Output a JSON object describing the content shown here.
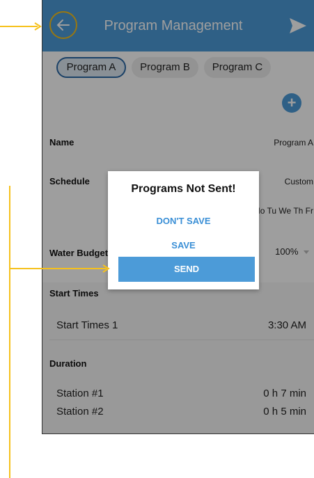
{
  "header": {
    "title": "Program Management"
  },
  "tabs": [
    {
      "label": "Program A",
      "active": true
    },
    {
      "label": "Program B",
      "active": false
    },
    {
      "label": "Program C",
      "active": false
    }
  ],
  "add_label": "+",
  "form": {
    "name_label": "Name",
    "name_value": "Program A",
    "schedule_label": "Schedule",
    "schedule_value": "Custom",
    "schedule_days": "Mo Tu We Th Fr",
    "budget_label": "Water Budget",
    "budget_value": "100%"
  },
  "start_times": {
    "label": "Start Times",
    "items": [
      {
        "name": "Start Times 1",
        "value": "3:30 AM"
      }
    ]
  },
  "duration": {
    "label": "Duration",
    "items": [
      {
        "name": "Station #1",
        "value": "0 h 7 min"
      },
      {
        "name": "Station #2",
        "value": "0 h 5 min"
      }
    ]
  },
  "dialog": {
    "title": "Programs Not Sent!",
    "dont_save": "DON'T SAVE",
    "save": "SAVE",
    "send": "SEND"
  },
  "colors": {
    "accent": "#4c9bd8",
    "callout": "#f6c11c"
  }
}
